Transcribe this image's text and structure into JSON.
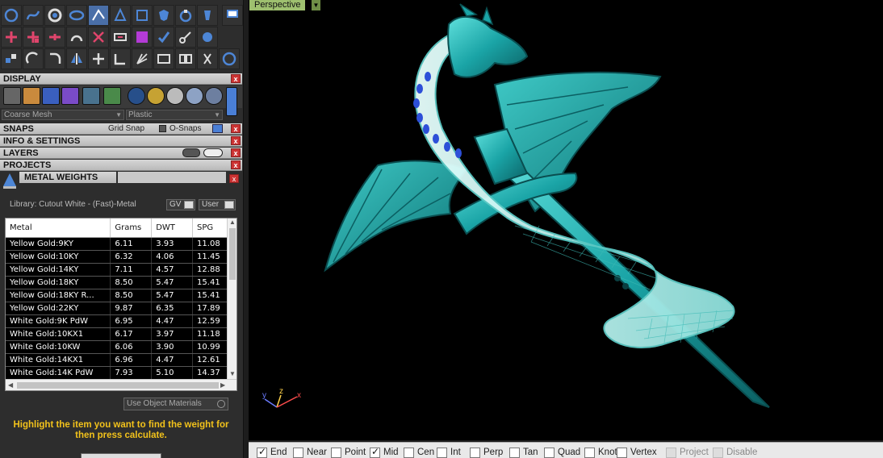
{
  "panel": {
    "display_label": "DISPLAY",
    "display_mesh": "Coarse Mesh",
    "display_material": "Plastic",
    "snaps_label": "SNAPS",
    "grid_snap": "Grid Snap",
    "osnaps": "O-Snaps",
    "info_label": "INFO & SETTINGS",
    "layers_label": "LAYERS",
    "projects_label": "PROJECTS",
    "metal_weights_label": "METAL WEIGHTS",
    "close_glyph": "x"
  },
  "metal_weights": {
    "library": "Library: Cutout White - (Fast)-Metal",
    "gv_label": "GV",
    "user_label": "User",
    "columns": [
      "Metal",
      "Grams",
      "DWT",
      "SPG"
    ],
    "rows": [
      [
        "Yellow Gold:9KY",
        "6.11",
        "3.93",
        "11.08"
      ],
      [
        "Yellow Gold:10KY",
        "6.32",
        "4.06",
        "11.45"
      ],
      [
        "Yellow Gold:14KY",
        "7.11",
        "4.57",
        "12.88"
      ],
      [
        "Yellow Gold:18KY",
        "8.50",
        "5.47",
        "15.41"
      ],
      [
        "Yellow Gold:18KY R...",
        "8.50",
        "5.47",
        "15.41"
      ],
      [
        "Yellow Gold:22KY",
        "9.87",
        "6.35",
        "17.89"
      ],
      [
        "White Gold:9K PdW",
        "6.95",
        "4.47",
        "12.59"
      ],
      [
        "White Gold:10KX1",
        "6.17",
        "3.97",
        "11.18"
      ],
      [
        "White Gold:10KW",
        "6.06",
        "3.90",
        "10.99"
      ],
      [
        "White Gold:14KX1",
        "6.96",
        "4.47",
        "12.61"
      ],
      [
        "White Gold:14K PdW",
        "7.93",
        "5.10",
        "14.37"
      ]
    ],
    "use_object_materials": "Use Object Materials",
    "hint": "Highlight the item you want to find the weight for then press calculate."
  },
  "viewport": {
    "tab_label": "Perspective",
    "axis_x": "x",
    "axis_y": "y",
    "axis_z": "z"
  },
  "statusbar": {
    "snaps": [
      {
        "label": "End",
        "checked": true,
        "enabled": true
      },
      {
        "label": "Near",
        "checked": false,
        "enabled": true
      },
      {
        "label": "Point",
        "checked": false,
        "enabled": true
      },
      {
        "label": "Mid",
        "checked": true,
        "enabled": true
      },
      {
        "label": "Cen",
        "checked": false,
        "enabled": true
      },
      {
        "label": "Int",
        "checked": false,
        "enabled": true
      },
      {
        "label": "Perp",
        "checked": false,
        "enabled": true
      },
      {
        "label": "Tan",
        "checked": false,
        "enabled": true
      },
      {
        "label": "Quad",
        "checked": false,
        "enabled": true
      },
      {
        "label": "Knot",
        "checked": false,
        "enabled": true
      },
      {
        "label": "Vertex",
        "checked": false,
        "enabled": true
      },
      {
        "label": "Project",
        "checked": false,
        "enabled": false
      },
      {
        "label": "Disable",
        "checked": false,
        "enabled": false
      }
    ]
  },
  "colors": {
    "model_teal": "#1aa4a6",
    "model_light": "#bff3f0",
    "accent_blue": "#2d4fd8",
    "hint_yellow": "#f2c21b"
  }
}
